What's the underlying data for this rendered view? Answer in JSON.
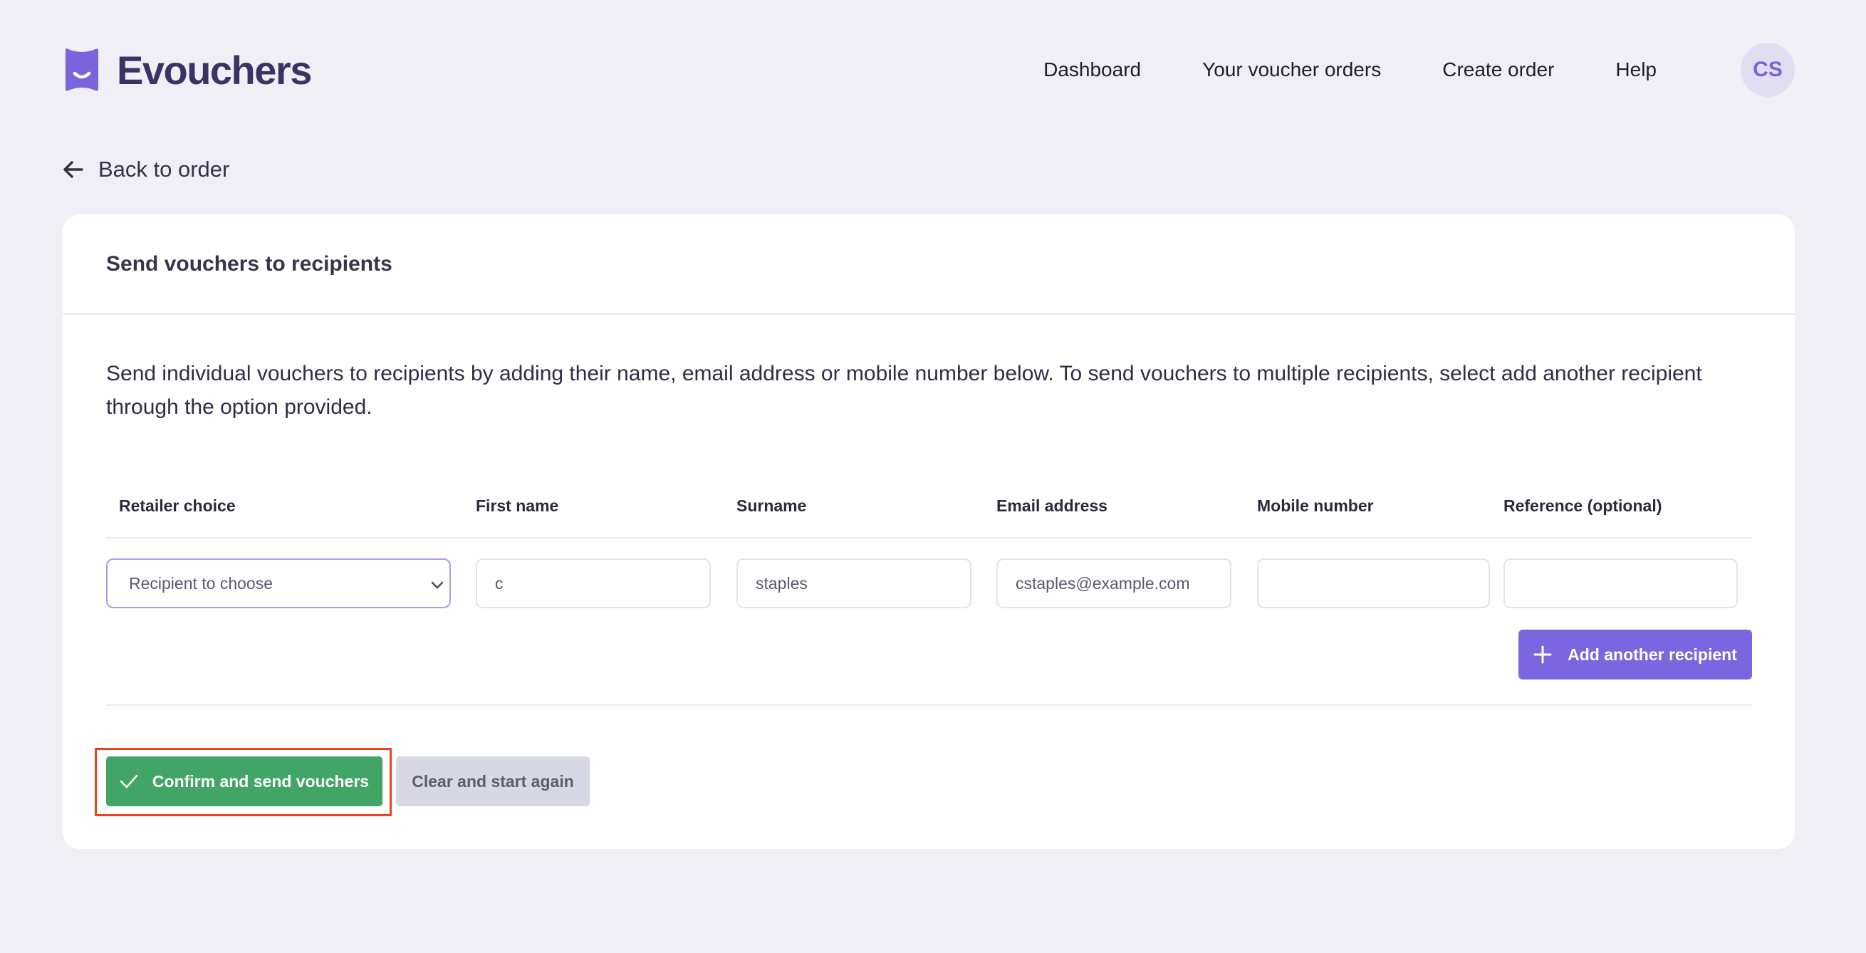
{
  "app": {
    "name": "Evouchers",
    "brand_color": "#7a63dc"
  },
  "nav": {
    "items": [
      {
        "label": "Dashboard"
      },
      {
        "label": "Your voucher orders"
      },
      {
        "label": "Create order"
      },
      {
        "label": "Help"
      }
    ],
    "avatar_initials": "CS"
  },
  "back_link": {
    "label": "Back to order",
    "icon": "arrow-left-icon"
  },
  "card": {
    "title": "Send vouchers to recipients",
    "intro": "Send individual vouchers to recipients by adding their name, email address or mobile number below. To send vouchers to multiple recipients, select add another recipient through the option provided."
  },
  "table": {
    "columns": [
      "Retailer choice",
      "First name",
      "Surname",
      "Email address",
      "Mobile number",
      "Reference (optional)"
    ],
    "row": {
      "retailer_choice": "Recipient to choose",
      "first_name": "c",
      "surname": "staples",
      "email": "cstaples@example.com",
      "mobile": "",
      "reference": ""
    }
  },
  "actions": {
    "add_recipient": "Add another recipient",
    "confirm": "Confirm and send vouchers",
    "clear": "Clear and start again"
  },
  "colors": {
    "confirm": "#43a565",
    "add": "#7b66e0",
    "highlight": "#e8451e"
  }
}
